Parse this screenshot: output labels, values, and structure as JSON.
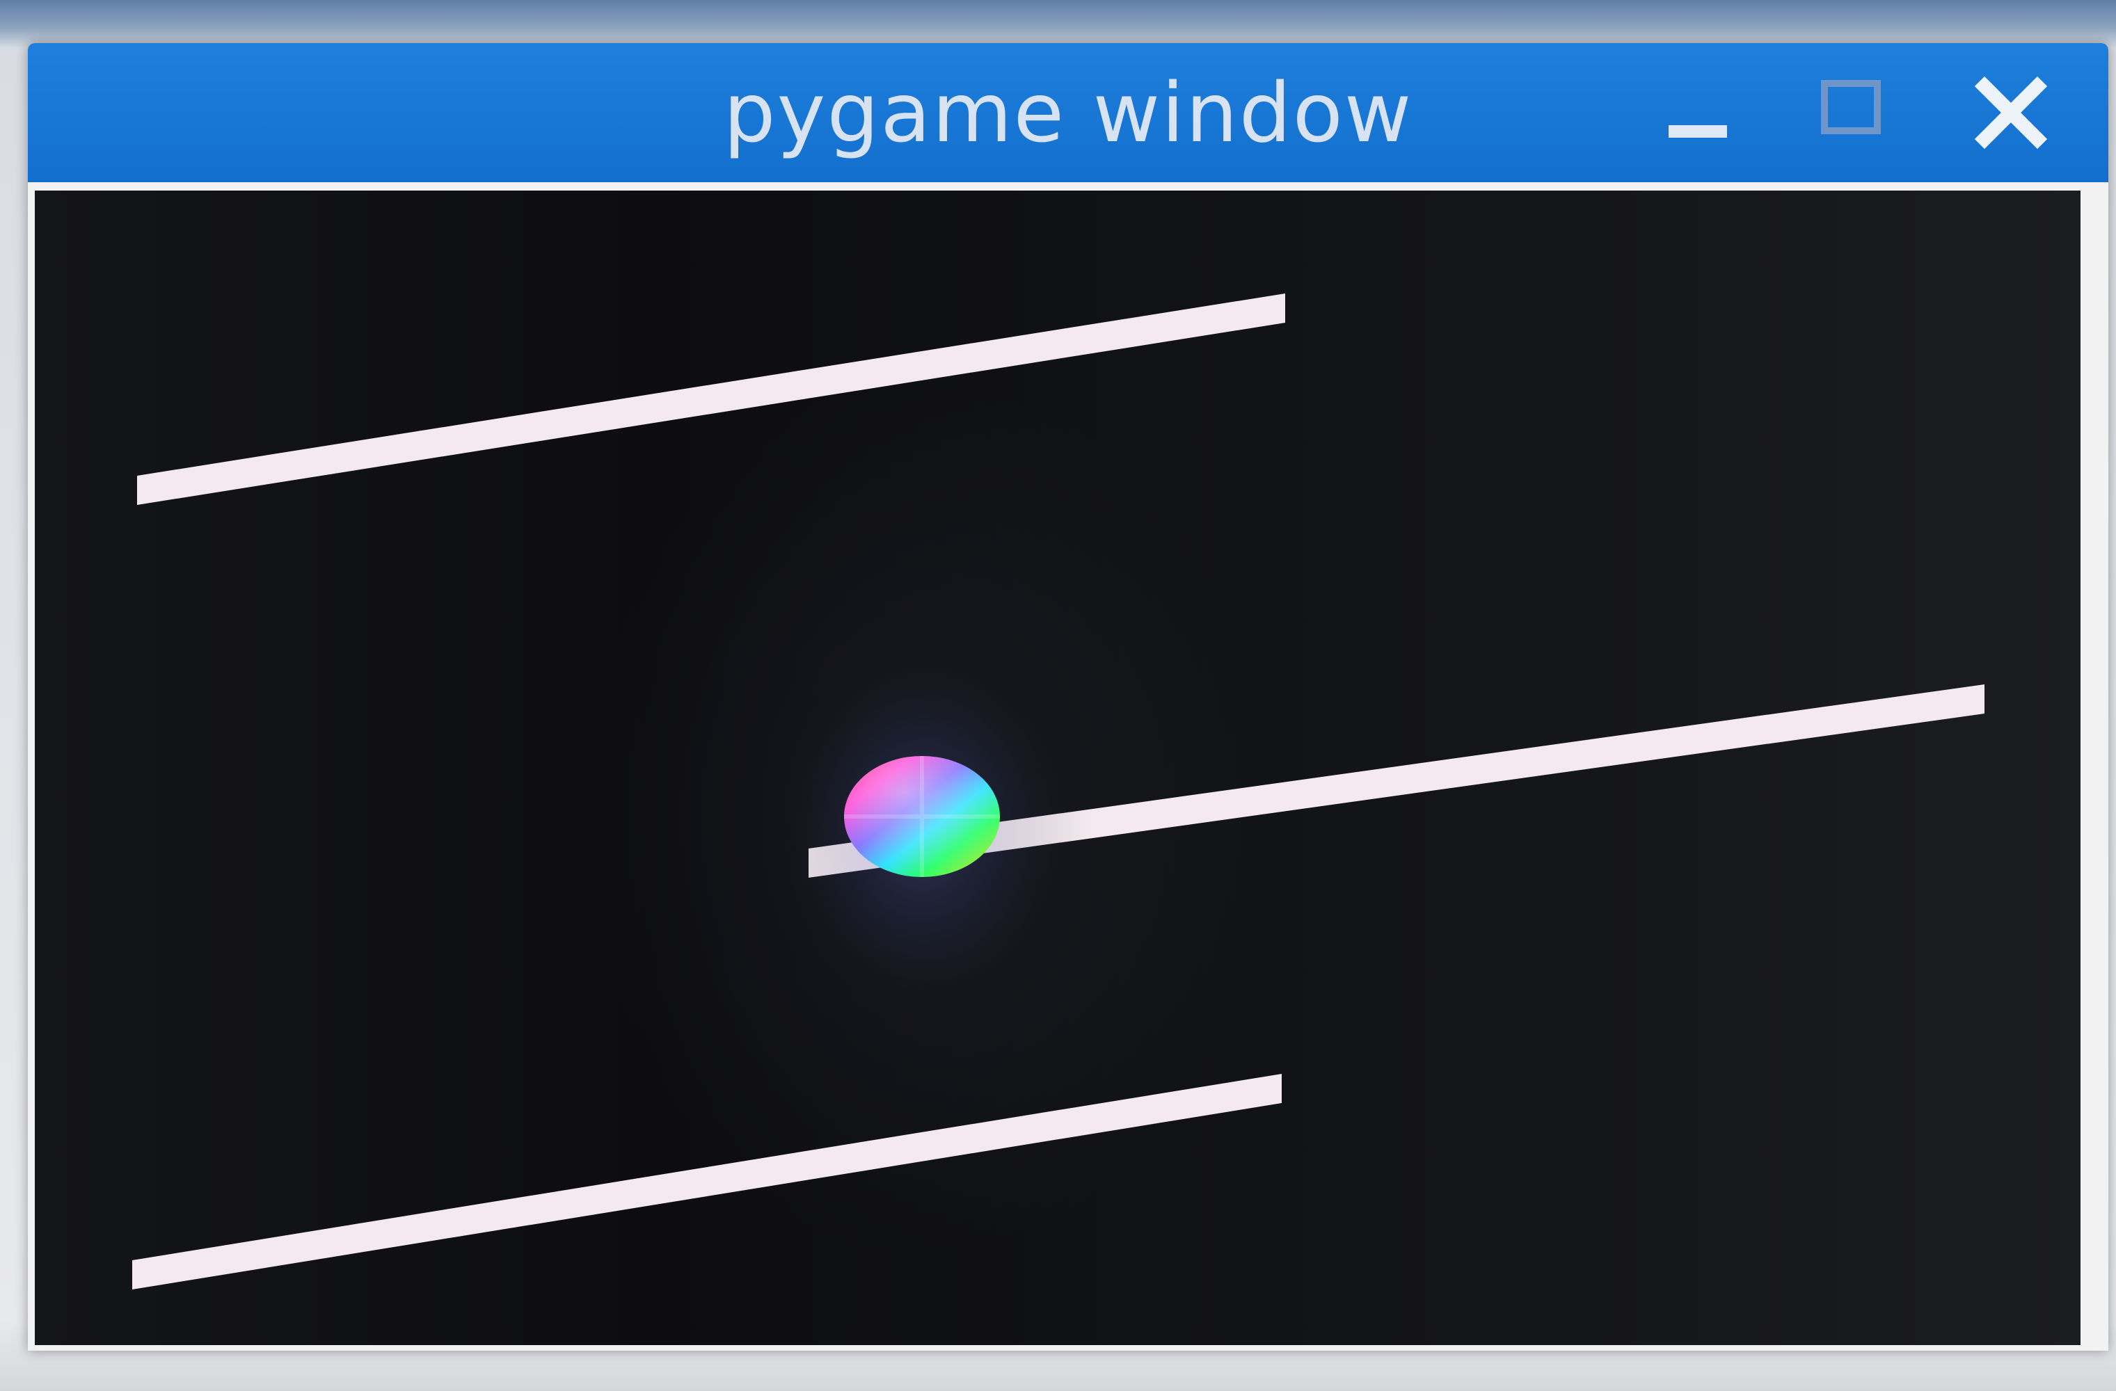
{
  "window": {
    "title": "pygame window",
    "controls": {
      "minimize_icon": "minimize-icon",
      "maximize_icon": "maximize-icon",
      "close_icon": "close-icon"
    },
    "titlebar_color": "#1976d8"
  },
  "game": {
    "background_color": "#111214",
    "platform_color": "#f3e9ee",
    "platforms_count": 3,
    "ball": {
      "style": "rainbow-gradient"
    }
  }
}
